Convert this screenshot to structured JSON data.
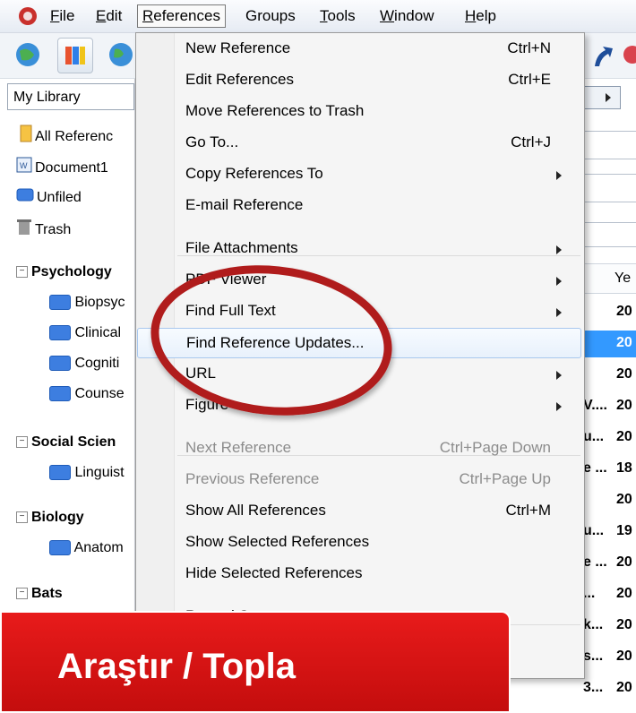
{
  "menubar": {
    "items": [
      {
        "label": "File",
        "underline": "F"
      },
      {
        "label": "Edit",
        "underline": "E"
      },
      {
        "label": "References",
        "underline": "R"
      },
      {
        "label": "Groups"
      },
      {
        "label": "Tools",
        "underline": "T"
      },
      {
        "label": "Window",
        "underline": "W"
      },
      {
        "label": "Help",
        "underline": "H"
      }
    ]
  },
  "sidebar": {
    "library_select": "My Library",
    "items": [
      {
        "label": "All Referenc",
        "icon": "all-references-icon"
      },
      {
        "label": "Document1",
        "icon": "word-document-icon"
      },
      {
        "label": "Unfiled",
        "icon": "unfiled-icon"
      },
      {
        "label": "Trash",
        "icon": "trash-icon"
      }
    ],
    "groups": [
      {
        "label": "Psychology",
        "children": [
          "Biopsyc",
          "Clinical",
          "Cogniti",
          "Counse"
        ]
      },
      {
        "label": "Social Scien",
        "children": [
          "Linguist"
        ]
      },
      {
        "label": "Biology",
        "children": [
          "Anatom"
        ]
      },
      {
        "label": "Bats",
        "children": []
      }
    ]
  },
  "right_panel": {
    "col_header": "Ye",
    "year_cells": [
      "20",
      "20",
      "20",
      "20",
      "20",
      "18",
      "20",
      "19",
      "20",
      "20",
      "20",
      "20",
      "20"
    ],
    "author_cells": [
      "",
      "",
      "",
      "V....",
      "u...",
      "e ...",
      "",
      "u...",
      "e ...",
      "...",
      "k...",
      "s...",
      "3..."
    ]
  },
  "references_menu": {
    "items": [
      {
        "label": "New Reference",
        "shortcut": "Ctrl+N"
      },
      {
        "label": "Edit References",
        "shortcut": "Ctrl+E"
      },
      {
        "label": "Move References to Trash",
        "shortcut": ""
      },
      {
        "label": "Go To...",
        "shortcut": "Ctrl+J"
      },
      {
        "label": "Copy References To",
        "shortcut": "",
        "submenu": true
      },
      {
        "label": "E-mail Reference",
        "shortcut": ""
      },
      {
        "label": "File Attachments",
        "shortcut": "",
        "submenu": true
      },
      {
        "label": "PDF Viewer",
        "shortcut": "",
        "submenu": true
      },
      {
        "label": "Find Full Text",
        "shortcut": "",
        "submenu": true
      },
      {
        "label": "Find Reference Updates...",
        "shortcut": "",
        "highlighted": true
      },
      {
        "label": "URL",
        "shortcut": "",
        "submenu": true
      },
      {
        "label": "Figure",
        "shortcut": "",
        "submenu": true
      },
      {
        "label": "Next Reference",
        "shortcut": "Ctrl+Page Down",
        "disabled": true
      },
      {
        "label": "Previous Reference",
        "shortcut": "Ctrl+Page Up",
        "disabled": true
      },
      {
        "label": "Show All References",
        "shortcut": "Ctrl+M"
      },
      {
        "label": "Show Selected References",
        "shortcut": ""
      },
      {
        "label": "Hide Selected References",
        "shortcut": ""
      },
      {
        "label": "Record Summary",
        "shortcut": ""
      }
    ]
  },
  "banner": {
    "text": "Araştır / Topla"
  },
  "colors": {
    "accent_red": "#d91515",
    "highlight_circle": "#b01c1c",
    "menu_bg": "#f5f5f5"
  }
}
